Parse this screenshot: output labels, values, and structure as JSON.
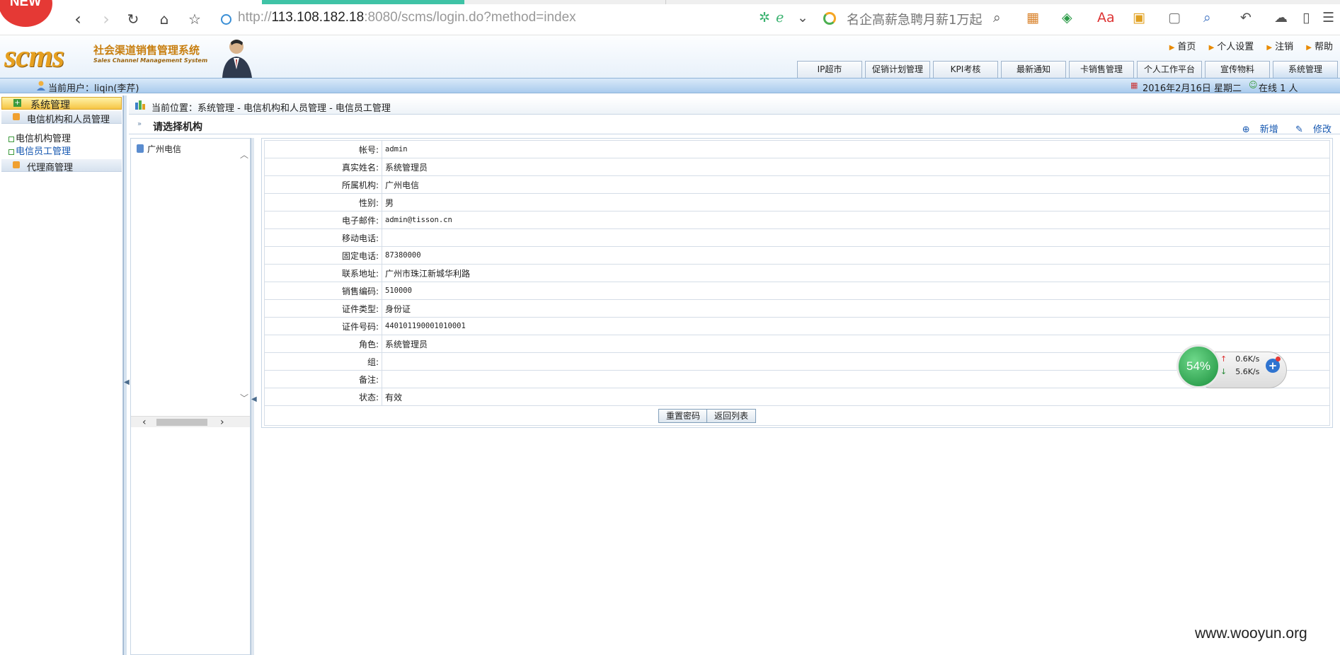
{
  "browser": {
    "badge": "NEW",
    "url_prefix": "http://",
    "url_host": "113.108.182.18",
    "url_rest": ":8080/scms/login.do?method=index",
    "search_text": "名企高薪急聘月薪1万起"
  },
  "app": {
    "logo_text": "scms",
    "logo_cn": "社会渠道销售管理系统",
    "logo_en": "Sales Channel Management System",
    "top_links": [
      "首页",
      "个人设置",
      "注销",
      "帮助"
    ],
    "nav_tabs": [
      "IP超市",
      "促销计划管理",
      "KPI考核",
      "最新通知",
      "卡销售管理",
      "个人工作平台",
      "宣传物料",
      "系统管理"
    ],
    "current_user": "当前用户：liqin(李芹)",
    "date": "2016年2月16日 星期二",
    "online": "在线 1 人"
  },
  "sidebar": {
    "header": "系统管理",
    "groups": [
      {
        "label": "电信机构和人员管理",
        "items": [
          "电信机构管理",
          "电信员工管理"
        ]
      },
      {
        "label": "代理商管理",
        "items": []
      }
    ]
  },
  "main": {
    "breadcrumb": "当前位置：系统管理 - 电信机构和人员管理 - 电信员工管理",
    "section_title": "请选择机构",
    "actions": {
      "add": "新增",
      "edit": "修改"
    },
    "tree": [
      "广州电信"
    ],
    "fields": [
      {
        "label": "帐号:",
        "value": "admin"
      },
      {
        "label": "真实姓名:",
        "value": "系统管理员"
      },
      {
        "label": "所属机构:",
        "value": "广州电信"
      },
      {
        "label": "性别:",
        "value": "男"
      },
      {
        "label": "电子邮件:",
        "value": "admin@tisson.cn"
      },
      {
        "label": "移动电话:",
        "value": ""
      },
      {
        "label": "固定电话:",
        "value": "87380000"
      },
      {
        "label": "联系地址:",
        "value": "广州市珠江新城华利路"
      },
      {
        "label": "销售编码:",
        "value": "510000"
      },
      {
        "label": "证件类型:",
        "value": "身份证"
      },
      {
        "label": "证件号码:",
        "value": "440101190001010001"
      },
      {
        "label": "角色:",
        "value": "系统管理员"
      },
      {
        "label": "组:",
        "value": ""
      },
      {
        "label": "备注:",
        "value": ""
      },
      {
        "label": "状态:",
        "value": "有效"
      }
    ],
    "buttons": {
      "reset_password": "重置密码",
      "back_to_list": "返回列表"
    }
  },
  "speed_widget": {
    "percent": "54%",
    "up": "0.6K/s",
    "down": "5.6K/s"
  },
  "watermark": "www.wooyun.org"
}
